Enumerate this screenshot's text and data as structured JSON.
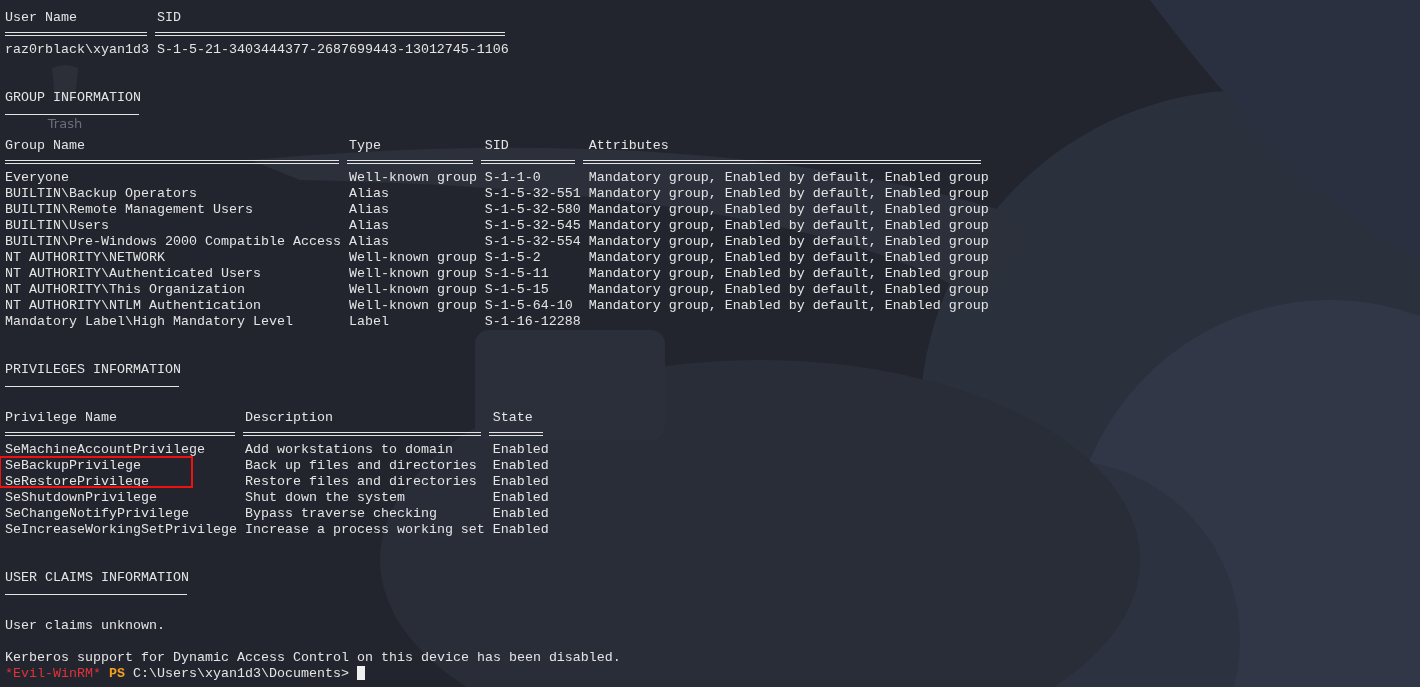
{
  "user_table": {
    "columns": [
      "User Name",
      "SID"
    ],
    "rows": [
      [
        "raz0rblack\\xyan1d3",
        "S-1-5-21-3403444377-2687699443-13012745-1106"
      ]
    ]
  },
  "group_information": {
    "heading": "GROUP INFORMATION",
    "columns": [
      "Group Name",
      "Type",
      "SID",
      "Attributes"
    ],
    "rows": [
      [
        "Everyone",
        "Well-known group",
        "S-1-1-0",
        "Mandatory group, Enabled by default, Enabled group"
      ],
      [
        "BUILTIN\\Backup Operators",
        "Alias",
        "S-1-5-32-551",
        "Mandatory group, Enabled by default, Enabled group"
      ],
      [
        "BUILTIN\\Remote Management Users",
        "Alias",
        "S-1-5-32-580",
        "Mandatory group, Enabled by default, Enabled group"
      ],
      [
        "BUILTIN\\Users",
        "Alias",
        "S-1-5-32-545",
        "Mandatory group, Enabled by default, Enabled group"
      ],
      [
        "BUILTIN\\Pre-Windows 2000 Compatible Access",
        "Alias",
        "S-1-5-32-554",
        "Mandatory group, Enabled by default, Enabled group"
      ],
      [
        "NT AUTHORITY\\NETWORK",
        "Well-known group",
        "S-1-5-2",
        "Mandatory group, Enabled by default, Enabled group"
      ],
      [
        "NT AUTHORITY\\Authenticated Users",
        "Well-known group",
        "S-1-5-11",
        "Mandatory group, Enabled by default, Enabled group"
      ],
      [
        "NT AUTHORITY\\This Organization",
        "Well-known group",
        "S-1-5-15",
        "Mandatory group, Enabled by default, Enabled group"
      ],
      [
        "NT AUTHORITY\\NTLM Authentication",
        "Well-known group",
        "S-1-5-64-10",
        "Mandatory group, Enabled by default, Enabled group"
      ],
      [
        "Mandatory Label\\High Mandatory Level",
        "Label",
        "S-1-16-12288"
      ]
    ]
  },
  "privileges_information": {
    "heading": "PRIVILEGES INFORMATION",
    "columns": [
      "Privilege Name",
      "Description",
      "State"
    ],
    "rows": [
      {
        "cells": [
          "SeMachineAccountPrivilege",
          "Add workstations to domain",
          "Enabled"
        ],
        "highlighted": false
      },
      {
        "cells": [
          "SeBackupPrivilege",
          "Back up files and directories",
          "Enabled"
        ],
        "highlighted": true
      },
      {
        "cells": [
          "SeRestorePrivilege",
          "Restore files and directories",
          "Enabled"
        ],
        "highlighted": true
      },
      {
        "cells": [
          "SeShutdownPrivilege",
          "Shut down the system",
          "Enabled"
        ],
        "highlighted": false
      },
      {
        "cells": [
          "SeChangeNotifyPrivilege",
          "Bypass traverse checking",
          "Enabled"
        ],
        "highlighted": false
      },
      {
        "cells": [
          "SeIncreaseWorkingSetPrivilege",
          "Increase a process working set",
          "Enabled"
        ],
        "highlighted": false
      }
    ]
  },
  "user_claims_information": {
    "heading": "USER CLAIMS INFORMATION",
    "lines": [
      "User claims unknown.",
      "Kerberos support for Dynamic Access Control on this device has been disabled."
    ]
  },
  "prompt": {
    "shell": "*Evil-WinRM*",
    "ps": "PS",
    "path": "C:\\Users\\xyan1d3\\Documents>"
  },
  "desktop_icons": [
    {
      "label": "Trash"
    }
  ]
}
